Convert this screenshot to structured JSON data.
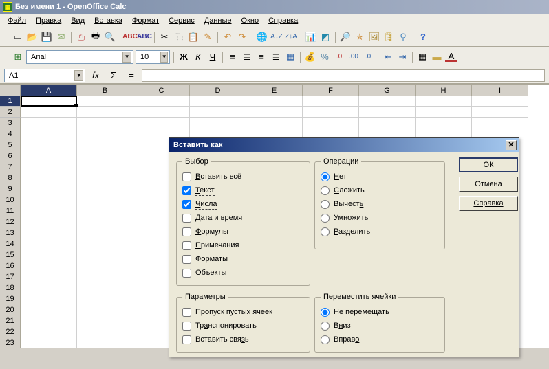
{
  "title": "Без имени 1 - OpenOffice Calc",
  "menu": {
    "file": "Файл",
    "edit": "Правка",
    "view": "Вид",
    "insert": "Вставка",
    "format": "Формат",
    "tools": "Сервис",
    "data": "Данные",
    "window": "Окно",
    "help": "Справка"
  },
  "toolbar": {
    "font_name": "Arial",
    "font_size": "10"
  },
  "formulabar": {
    "cell_ref": "A1",
    "fx": "fx",
    "sigma": "Σ",
    "eq": "="
  },
  "cols": [
    "A",
    "B",
    "C",
    "D",
    "E",
    "F",
    "G",
    "H",
    "I"
  ],
  "rows": [
    "1",
    "2",
    "3",
    "4",
    "5",
    "6",
    "7",
    "8",
    "9",
    "10",
    "11",
    "12",
    "13",
    "14",
    "15",
    "16",
    "17",
    "18",
    "19",
    "20",
    "21",
    "22",
    "23"
  ],
  "dialog": {
    "title": "Вставить как",
    "group_select": "Выбор",
    "opt_paste_all": "Вставить всё",
    "opt_text": "Текст",
    "opt_numbers": "Числа",
    "opt_datetime": "Дата и время",
    "opt_formulas": "Формулы",
    "opt_comments": "Примечания",
    "opt_formats": "Форматы",
    "opt_objects": "Объекты",
    "group_ops": "Операции",
    "op_none": "Нет",
    "op_add": "Сложить",
    "op_sub": "Вычесть",
    "op_mul": "Умножить",
    "op_div": "Разделить",
    "group_params": "Параметры",
    "par_skip": "Пропуск пустых ячеек",
    "par_transpose": "Транспонировать",
    "par_link": "Вставить связь",
    "group_shift": "Переместить ячейки",
    "sh_none": "Не перемещать",
    "sh_down": "Вниз",
    "sh_right": "Вправо",
    "btn_ok": "ОК",
    "btn_cancel": "Отмена",
    "btn_help": "Справка"
  }
}
